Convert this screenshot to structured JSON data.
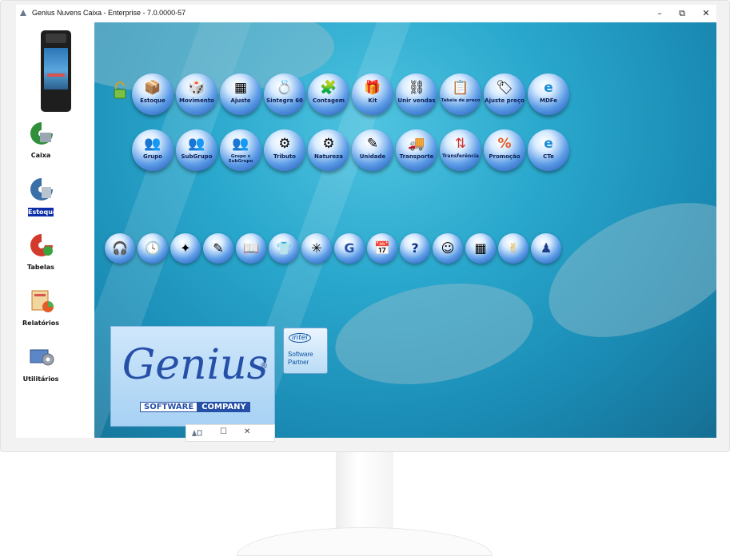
{
  "window": {
    "title": "Genius Nuvens Caixa - Enterprise - 7.0.0000-57",
    "minimize": "–",
    "restore": "⧉",
    "close": "✕"
  },
  "sidebar": {
    "items": [
      {
        "label": "Caixa",
        "icon": "cash-register-icon"
      },
      {
        "label": "Estoque",
        "icon": "stock-icon",
        "active": true
      },
      {
        "label": "Tabelas",
        "icon": "tables-icon"
      },
      {
        "label": "Relatórios",
        "icon": "reports-icon"
      },
      {
        "label": "Utilitários",
        "icon": "utilities-icon"
      }
    ]
  },
  "toolbar_row1": [
    {
      "label": "Estoque",
      "glyph": "📦"
    },
    {
      "label": "Movimento",
      "glyph": "🎲"
    },
    {
      "label": "Ajuste",
      "glyph": "▦"
    },
    {
      "label": "Sintegra 60",
      "glyph": "💍"
    },
    {
      "label": "Contagem",
      "glyph": "🧩"
    },
    {
      "label": "Kit",
      "glyph": "🎁"
    },
    {
      "label": "Unir vendas",
      "glyph": "⛓"
    },
    {
      "label": "Tabela de preço",
      "glyph": "📋"
    },
    {
      "label": "Ajuste preço",
      "glyph": "🏷"
    },
    {
      "label": "MDFe",
      "glyph": "e"
    }
  ],
  "toolbar_row2": [
    {
      "label": "Grupo",
      "glyph": "👥"
    },
    {
      "label": "SubGrupo",
      "glyph": "👥"
    },
    {
      "label": "Grupo x SubGrupo",
      "glyph": "👥"
    },
    {
      "label": "Tributo",
      "glyph": "⚙"
    },
    {
      "label": "Natureza",
      "glyph": "⚙"
    },
    {
      "label": "Unidade",
      "glyph": "✎"
    },
    {
      "label": "Transporte",
      "glyph": "🚚"
    },
    {
      "label": "Transferência",
      "glyph": "⇅"
    },
    {
      "label": "Promoção",
      "glyph": "%"
    },
    {
      "label": "CTe",
      "glyph": "e"
    }
  ],
  "quick_row": [
    {
      "icon": "headset-icon",
      "glyph": "🎧"
    },
    {
      "icon": "clock-icon",
      "glyph": "🕓"
    },
    {
      "icon": "sparkle-icon",
      "glyph": "✦"
    },
    {
      "icon": "note-icon",
      "glyph": "✎"
    },
    {
      "icon": "book-icon",
      "glyph": "📖"
    },
    {
      "icon": "shirt-icon",
      "glyph": "👕"
    },
    {
      "icon": "star-icon",
      "glyph": "✳"
    },
    {
      "icon": "genius-g-icon",
      "glyph": "G"
    },
    {
      "icon": "calendar-icon",
      "glyph": "📅"
    },
    {
      "icon": "help-icon",
      "glyph": "?"
    },
    {
      "icon": "user-icon",
      "glyph": "☺"
    },
    {
      "icon": "calculator-icon",
      "glyph": "▦"
    },
    {
      "icon": "messenger-icon",
      "glyph": "✌"
    },
    {
      "icon": "person-icon",
      "glyph": "♟"
    }
  ],
  "logo": {
    "name": "Genius",
    "reg": "®",
    "software": "SOFTWARE",
    "company": "COMPANY"
  },
  "intel": {
    "brand": "intel",
    "line1": "Software",
    "line2": "Partner"
  },
  "mini_titlebar": {
    "restore": "☐",
    "close": "✕"
  }
}
